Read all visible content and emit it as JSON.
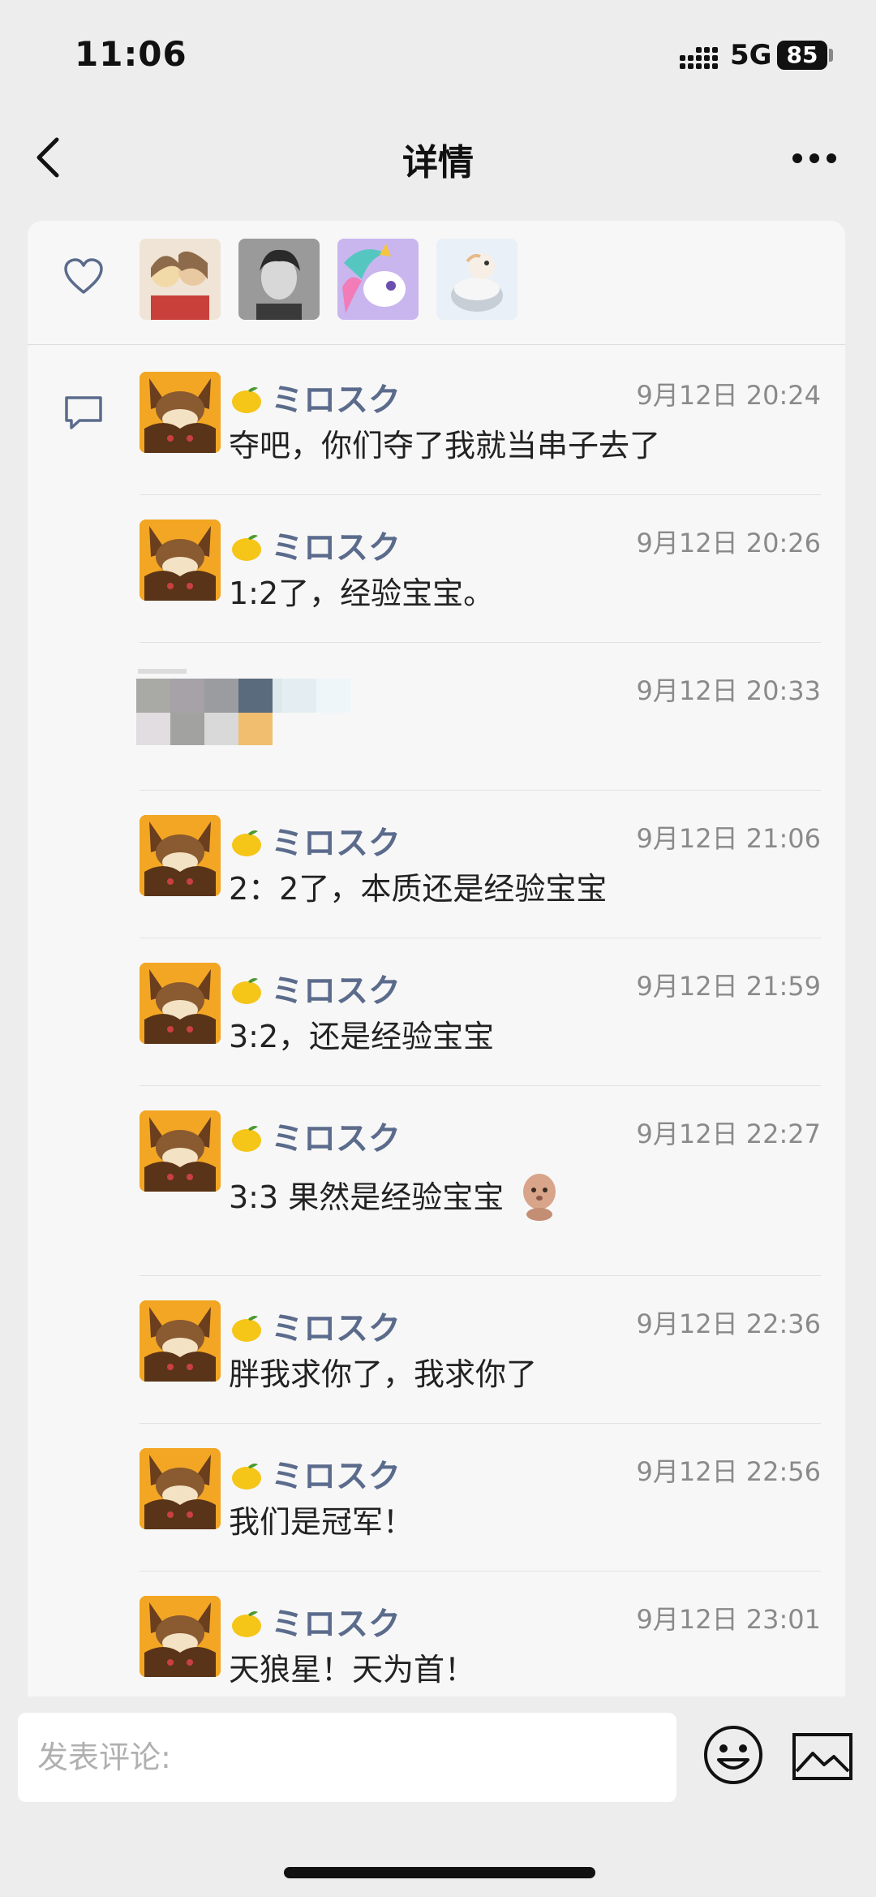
{
  "status_bar": {
    "time": "11:06",
    "network": "5G",
    "battery": "85"
  },
  "nav": {
    "title": "详情",
    "back_icon": "chevron-left-icon",
    "more_icon": "more-dots-icon"
  },
  "likes": {
    "icon": "heart-icon",
    "count_shown": 4
  },
  "comments": [
    {
      "user": "ミロスク",
      "time": "9月12日 20:24",
      "text": "夺吧，你们夺了我就当串子去了"
    },
    {
      "user": "ミロスク",
      "time": "9月12日 20:26",
      "text": "1:2了，经验宝宝。"
    },
    {
      "user": "",
      "time": "9月12日 20:33",
      "text": ""
    },
    {
      "user": "ミロスク",
      "time": "9月12日 21:06",
      "text": "2：2了，本质还是经验宝宝"
    },
    {
      "user": "ミロスク",
      "time": "9月12日 21:59",
      "text": "3:2，还是经验宝宝"
    },
    {
      "user": "ミロスク",
      "time": "9月12日 22:27",
      "text": "3:3 果然是经验宝宝"
    },
    {
      "user": "ミロスク",
      "time": "9月12日 22:36",
      "text": "胖我求你了，我求你了"
    },
    {
      "user": "ミロスク",
      "time": "9月12日 22:56",
      "text": "我们是冠军！"
    },
    {
      "user": "ミロスク",
      "time": "9月12日 23:01",
      "text": "天狼星！天为首！"
    }
  ],
  "composer": {
    "placeholder": "发表评论:",
    "emoji_icon": "emoji-icon",
    "image_icon": "image-icon"
  },
  "colors": {
    "username": "#5b6b8c",
    "timestamp": "#8a8a8a",
    "background": "#ededed",
    "card": "#f7f7f7"
  }
}
